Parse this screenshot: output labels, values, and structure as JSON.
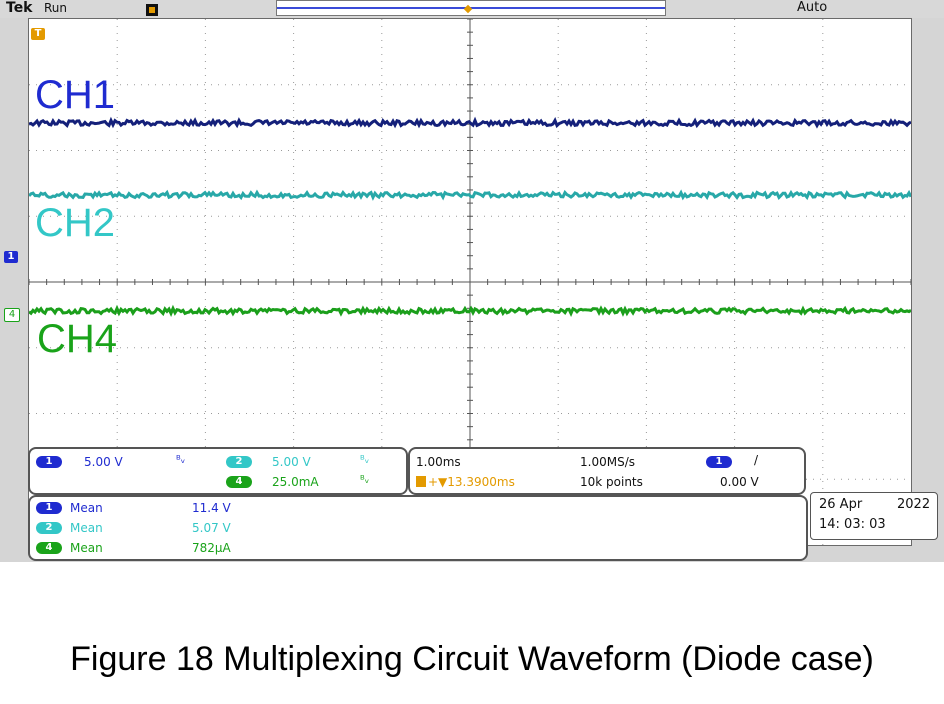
{
  "header": {
    "brand": "Tek",
    "run_status": "Run",
    "trigger_mode": "Auto"
  },
  "channels": [
    {
      "id": "1",
      "label": "CH1",
      "color": "#1f2bd0",
      "trace_color": "#14207a",
      "scale": "5.00 V",
      "mean": "11.4 V"
    },
    {
      "id": "2",
      "label": "CH2",
      "color": "#33c7c7",
      "trace_color": "#28a8a8",
      "scale": "5.00 V",
      "mean": "5.07 V"
    },
    {
      "id": "4",
      "label": "CH4",
      "color": "#1aa31a",
      "trace_color": "#1b9f1b",
      "scale": "25.0mA",
      "mean": "782µA"
    }
  ],
  "markers": {
    "trigger_marker": "T",
    "ch1_ground_marker": "1",
    "ch4_ground_marker": "4"
  },
  "timebase": {
    "horizontal_scale": "1.00ms",
    "sample_rate": "1.00MS/s",
    "delay": "+▼13.3900ms",
    "record_length": "10k points",
    "trigger_source": "1",
    "trigger_slope": "/",
    "trigger_level": "0.00 V"
  },
  "measurements": {
    "mean_label": "Mean"
  },
  "datetime": {
    "date": "26 Apr",
    "year": "2022",
    "time": "14: 03: 03"
  },
  "caption": "Figure 18 Multiplexing Circuit Waveform (Diode case)"
}
